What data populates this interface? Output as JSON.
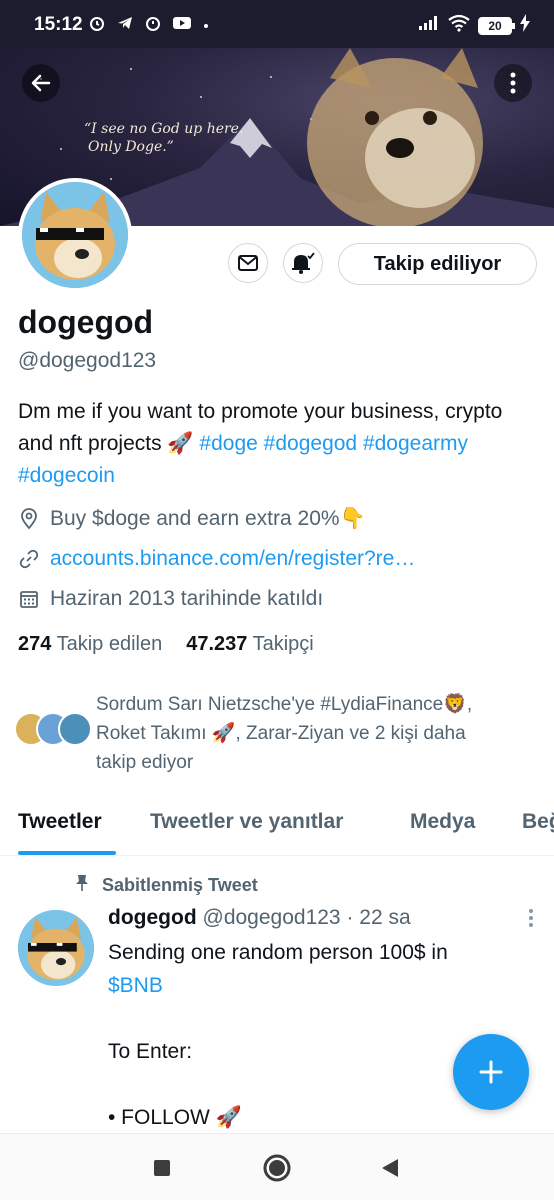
{
  "status_bar": {
    "time": "15:12",
    "battery": "20"
  },
  "banner": {
    "quote_line1": "“I see no God up here.",
    "quote_line2": "Only Doge.”"
  },
  "profile": {
    "follow_button": "Takip ediliyor",
    "name": "dogegod",
    "handle": "@dogegod123",
    "bio_text": "Dm me if you want to promote your business, crypto and nft projects 🚀",
    "bio_tags": [
      "#doge",
      "#dogegod",
      "#dogearmy",
      "#dogecoin"
    ],
    "location": "Buy $doge and earn extra 20%👇",
    "website": "accounts.binance.com/en/register?re…",
    "joined": "Haziran 2013 tarihinde katıldı",
    "following_count": "274",
    "following_label": "Takip edilen",
    "followers_count": "47.237",
    "followers_label": "Takipçi",
    "followed_by_line1": "Sordum Sarı Nietzsche'ye #LydiaFinance🦁,",
    "followed_by_line2": "Roket Takımı 🚀, Zarar-Ziyan ve 2 kişi daha",
    "followed_by_line3": "takip ediyor"
  },
  "tabs": [
    "Tweetler",
    "Tweetler ve yanıtlar",
    "Medya",
    "Beğe"
  ],
  "tweet": {
    "pinned_label": "Sabitlenmiş Tweet",
    "author_name": "dogegod",
    "author_handle": "@dogegod123",
    "time": "· 22 sa",
    "line1": "Sending one random person 100$ in",
    "line2_link": "$BNB",
    "line3": "To Enter:",
    "line4": "• FOLLOW 🚀"
  },
  "colors": {
    "accent": "#1d9bf0",
    "text": "#0f1419",
    "muted": "#536471",
    "statusbar": "#1b1c2e"
  }
}
